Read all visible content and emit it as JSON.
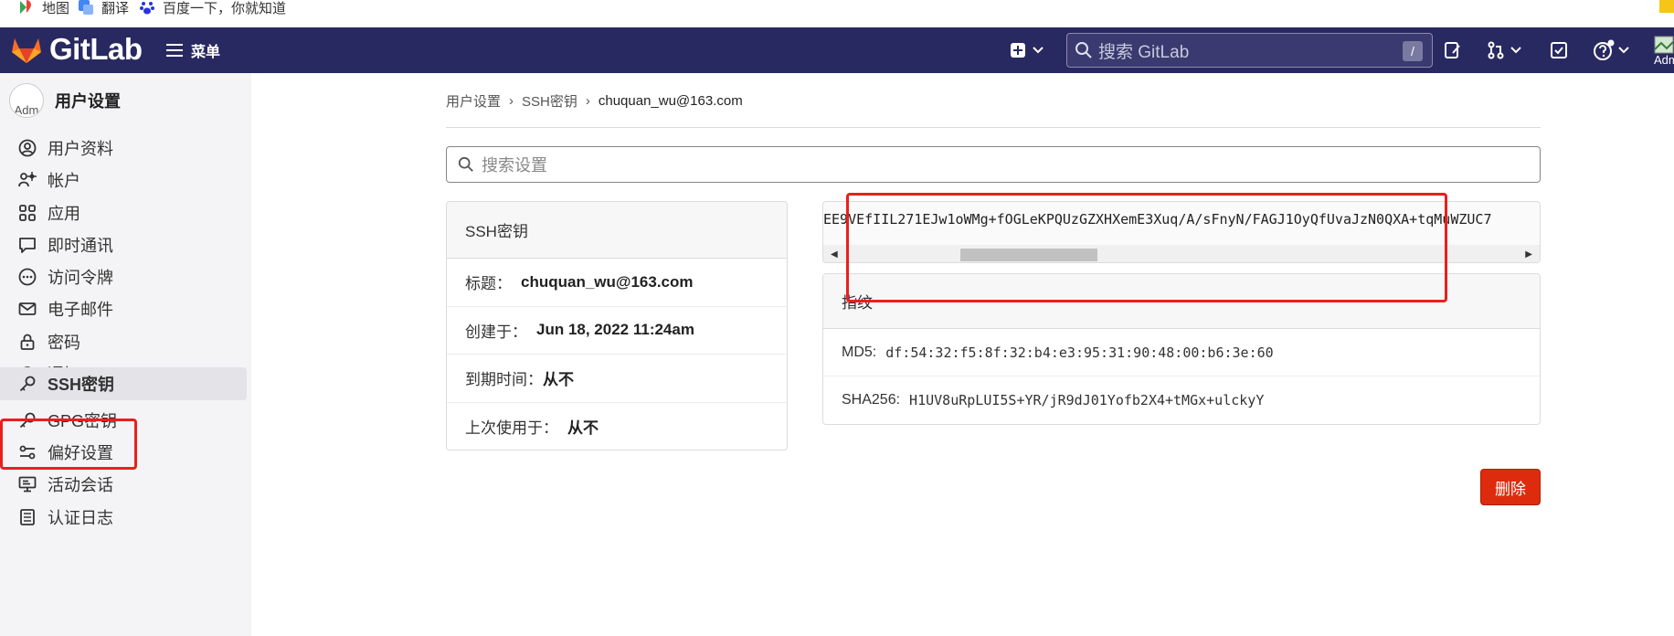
{
  "bookmarks": [
    "地图",
    "翻译",
    "百度一下，你就知道"
  ],
  "topbar": {
    "brand": "GitLab",
    "menu_label": "菜单",
    "search_placeholder": "搜索 GitLab",
    "search_shortcut": "/",
    "user_avatar_alt": "Adm"
  },
  "sidebar": {
    "avatar_alt": "Adm",
    "title": "用户设置",
    "items": [
      {
        "label": "用户资料",
        "icon": "profile-icon"
      },
      {
        "label": "帐户",
        "icon": "account-icon"
      },
      {
        "label": "应用",
        "icon": "applications-icon"
      },
      {
        "label": "即时通讯",
        "icon": "chat-icon"
      },
      {
        "label": "访问令牌",
        "icon": "token-icon"
      },
      {
        "label": "电子邮件",
        "icon": "mail-icon"
      },
      {
        "label": "密码",
        "icon": "lock-icon"
      },
      {
        "label": "通知",
        "icon": "bell-icon"
      },
      {
        "label": "SSH密钥",
        "icon": "key-icon",
        "active": true
      },
      {
        "label": "GPG密钥",
        "icon": "key-icon"
      },
      {
        "label": "偏好设置",
        "icon": "preferences-icon"
      },
      {
        "label": "活动会话",
        "icon": "monitor-icon"
      },
      {
        "label": "认证日志",
        "icon": "log-icon"
      }
    ]
  },
  "breadcrumb": [
    "用户设置",
    "SSH密钥",
    "chuquan_wu@163.com"
  ],
  "settings_search": {
    "placeholder": "搜索设置"
  },
  "key_card": {
    "header": "SSH密钥",
    "rows": [
      {
        "label": "标题：",
        "value": "chuquan_wu@163.com"
      },
      {
        "label": "创建于：",
        "value": "Jun 18, 2022 11:24am"
      },
      {
        "label": "到期时间：",
        "value": "从不"
      },
      {
        "label": "上次使用于：",
        "value": "从不"
      }
    ]
  },
  "key_text": "EE9VEfIIL271EJw1oWMg+fOGLeKPQUzGZXHXemE3Xuq/A/sFnyN/FAGJ1OyQfUvaJzN0QXA+tqMuWZUC7",
  "fingerprints": {
    "header": "指纹",
    "md5_label": "MD5:",
    "md5": "df:54:32:f5:8f:32:b4:e3:95:31:90:48:00:b6:3e:60",
    "sha256_label": "SHA256:",
    "sha256": "H1UV8uRpLUI5S+YR/jR9dJ01Yofb2X4+tMGx+ulckyY"
  },
  "delete_label": "删除",
  "colors": {
    "topbar": "#292961",
    "danger": "#dd2b0e",
    "highlight": "#e8201c"
  }
}
